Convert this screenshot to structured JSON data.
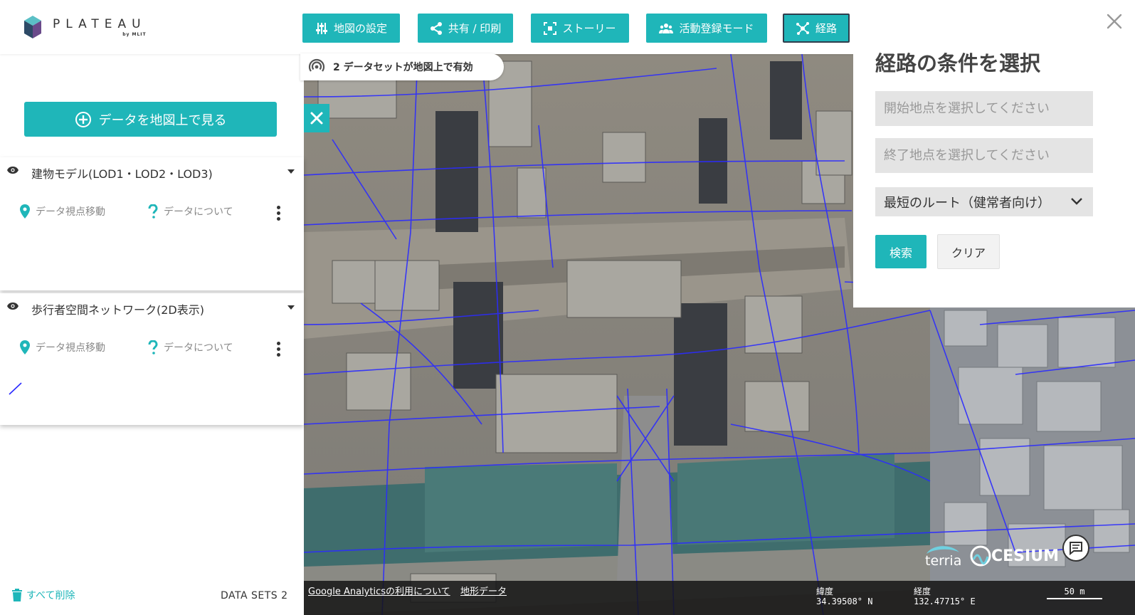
{
  "header": {
    "logo": {
      "title": "PLATEAU",
      "subtitle": "by MLIT"
    },
    "buttons": [
      {
        "label": "地図の設定",
        "icon": "sliders-icon"
      },
      {
        "label": "共有 / 印刷",
        "icon": "share-icon"
      },
      {
        "label": "ストーリー",
        "icon": "story-icon"
      },
      {
        "label": "活動登録モード",
        "icon": "users-icon"
      },
      {
        "label": "経路",
        "icon": "route-icon",
        "active": true
      }
    ]
  },
  "sidebar": {
    "view_data_label": "データを地図上で見る",
    "datasets": [
      {
        "title": "建物モデル(LOD1・LOD2・LOD3)",
        "zoom_label": "データ視点移動",
        "about_label": "データについて"
      },
      {
        "title": "歩行者空間ネットワーク(2D表示)",
        "zoom_label": "データ視点移動",
        "about_label": "データについて"
      }
    ],
    "clear_all_label": "すべて削除",
    "datasets_count_label": "DATA SETS 2"
  },
  "map": {
    "dataset_status": "2 データセットが地図上で有効",
    "footer": {
      "analytics_link": "Google Analyticsの利用について",
      "terrain_link": "地形データ",
      "lat_label": "緯度",
      "lat_value": "34.39508° N",
      "lon_label": "経度",
      "lon_value": "132.47715° E",
      "scale_label": "50 m"
    },
    "credits": {
      "terria": "terria",
      "cesium": "CESIUM"
    },
    "network_color": "#2b2bff"
  },
  "route_panel": {
    "title": "経路の条件を選択",
    "start_placeholder": "開始地点を選択してください",
    "end_placeholder": "終了地点を選択してください",
    "route_option": "最短のルート（健常者向け）",
    "search_label": "検索",
    "clear_label": "クリア"
  },
  "colors": {
    "accent": "#1fb6b9",
    "active_border": "#2f3d4c"
  }
}
